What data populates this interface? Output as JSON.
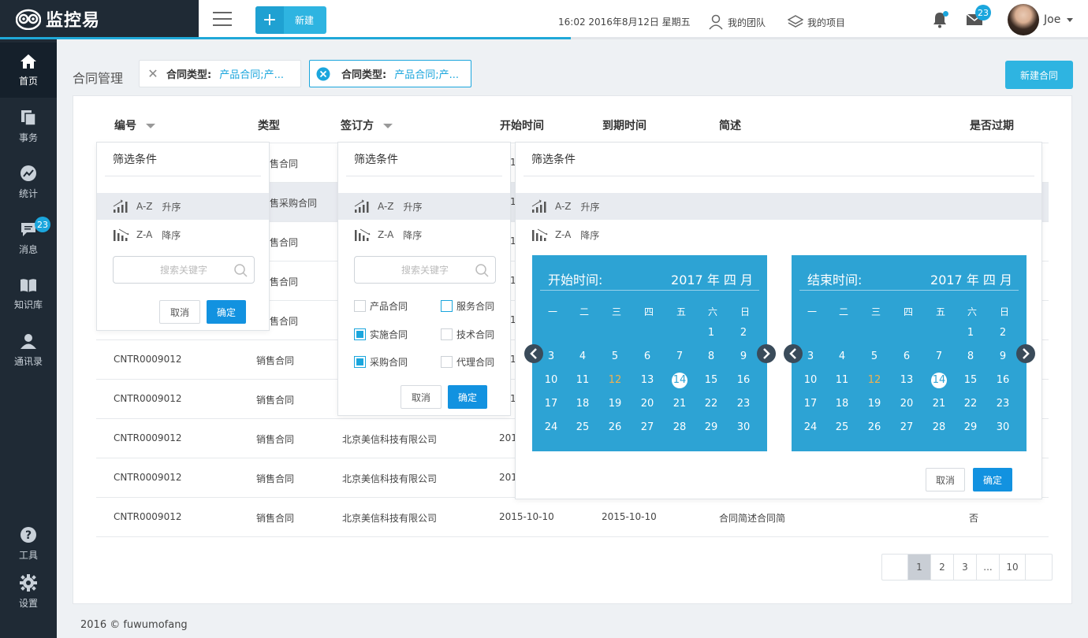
{
  "app": {
    "name": "监控易"
  },
  "header": {
    "new_label": "新建",
    "datetime": "16:02 2016年8月12日 星期五",
    "team_label": "我的团队",
    "project_label": "我的项目",
    "mail_count": "23",
    "user_name": "Joe"
  },
  "sidebar": {
    "items": [
      {
        "label": "首页",
        "icon": "home-icon"
      },
      {
        "label": "事务",
        "icon": "documents-icon"
      },
      {
        "label": "统计",
        "icon": "chart-icon"
      },
      {
        "label": "消息",
        "icon": "message-icon",
        "badge": "23"
      },
      {
        "label": "知识库",
        "icon": "book-icon"
      },
      {
        "label": "通讯录",
        "icon": "contact-icon"
      },
      {
        "label": "工具",
        "icon": "help-icon"
      },
      {
        "label": "设置",
        "icon": "gear-icon"
      }
    ]
  },
  "page": {
    "title": "合同管理",
    "new_contract": "新建合同",
    "filters": [
      {
        "key": "合同类型:",
        "value": "产品合同;产..."
      },
      {
        "key": "合同类型:",
        "value": "产品合同;产..."
      }
    ]
  },
  "table": {
    "headers": [
      "编号",
      "类型",
      "签订方",
      "开始时间",
      "到期时间",
      "简述",
      "是否过期"
    ],
    "partial_type": [
      "售合同",
      "售采购合同",
      "售合同",
      "售合同",
      "售合同"
    ],
    "partial_start": [
      "1",
      "1",
      "1",
      "1",
      "1"
    ],
    "rows": [
      {
        "id": "CNTR0009012",
        "type": "销售合同",
        "party": "",
        "start": "1"
      },
      {
        "id": "CNTR0009012",
        "type": "销售合同",
        "party": "",
        "start": "1"
      },
      {
        "id": "CNTR0009012",
        "type": "销售合同",
        "party": "北京美信科技有限公司",
        "start": "201"
      },
      {
        "id": "CNTR0009012",
        "type": "销售合同",
        "party": "北京美信科技有限公司",
        "start": "201"
      },
      {
        "id": "CNTR0009012",
        "type": "销售合同",
        "party": "北京美信科技有限公司",
        "start": "2015-10-10",
        "end": "2015-10-10",
        "desc": "合同简述合同简",
        "expired": "否"
      }
    ]
  },
  "dropdown": {
    "title": "筛选条件",
    "asc_code": "A-Z",
    "asc_label": "升序",
    "desc_code": "Z-A",
    "desc_label": "降序",
    "search_placeholder": "搜索关键字",
    "cancel": "取消",
    "ok": "确定",
    "options": [
      {
        "label": "产品合同",
        "state": "off"
      },
      {
        "label": "服务合同",
        "state": "outline"
      },
      {
        "label": "实施合同",
        "state": "on"
      },
      {
        "label": "技术合同",
        "state": "off"
      },
      {
        "label": "采购合同",
        "state": "on"
      },
      {
        "label": "代理合同",
        "state": "off"
      }
    ]
  },
  "calendar": {
    "start_label": "开始时间:",
    "end_label": "结束时间:",
    "month_label": "2017 年 四 月",
    "weekdays": [
      "一",
      "二",
      "三",
      "四",
      "五",
      "六",
      "日"
    ],
    "weeks": [
      [
        "",
        "",
        "",
        "",
        "",
        "1",
        "2"
      ],
      [
        "3",
        "4",
        "5",
        "6",
        "7",
        "8",
        "9"
      ],
      [
        "10",
        "11",
        "12",
        "13",
        "14",
        "15",
        "16"
      ],
      [
        "17",
        "18",
        "19",
        "20",
        "21",
        "22",
        "23"
      ],
      [
        "24",
        "25",
        "26",
        "27",
        "28",
        "29",
        "30"
      ]
    ],
    "highlight_day": "12",
    "selected_day": "14"
  },
  "pager": {
    "pages": [
      "1",
      "2",
      "3",
      "...",
      "10"
    ],
    "current": "1"
  },
  "footer": {
    "text": "2016 © fuwumofang"
  },
  "colors": {
    "accent": "#1ba6dd",
    "sidebar": "#1f2a35",
    "calendar": "#2da3d4",
    "primary_button": "#1292e0"
  }
}
